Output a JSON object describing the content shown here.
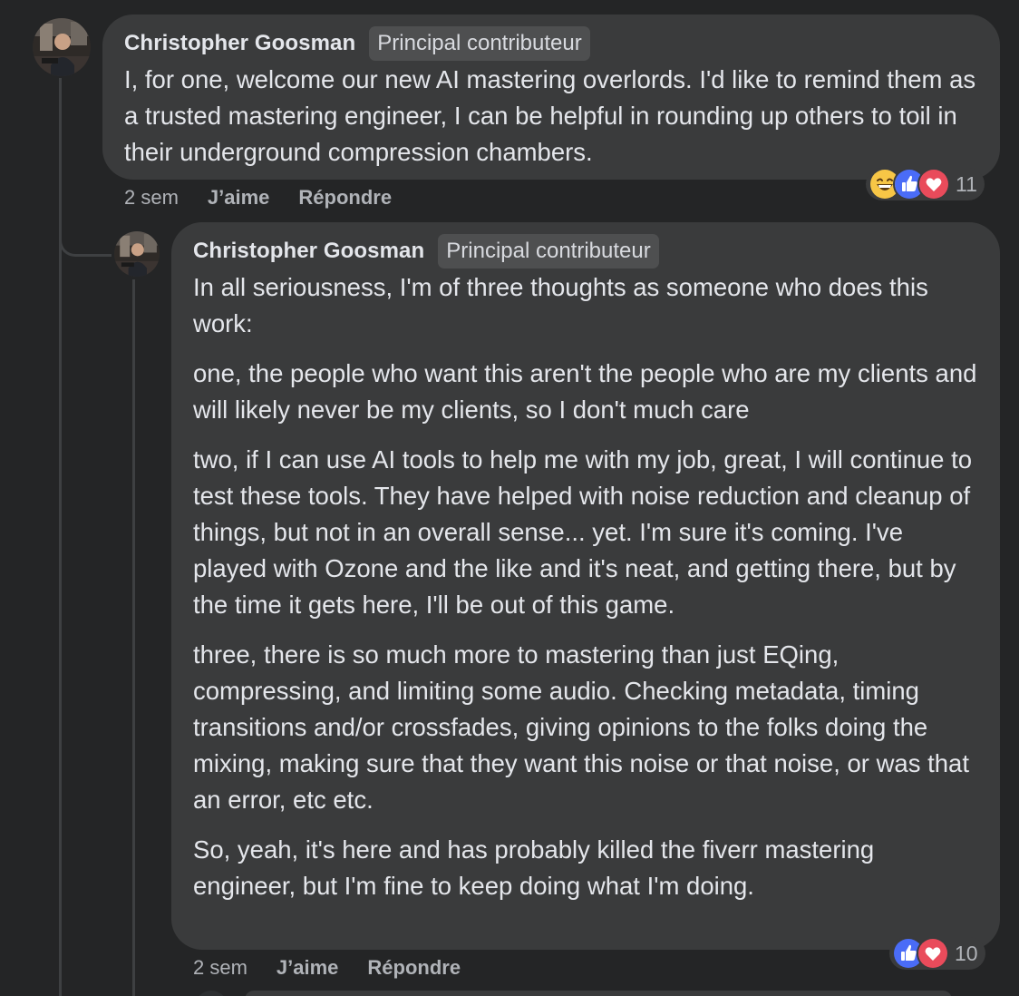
{
  "comments": [
    {
      "author": "Christopher Goosman",
      "badge": "Principal contributeur",
      "paragraphs": [
        "I, for one, welcome our new AI mastering overlords. I'd like to remind them as a trusted mastering engineer, I can be helpful in rounding up others to toil in their underground compression chambers."
      ],
      "time": "2 sem",
      "like_label": "J’aime",
      "reply_label": "Répondre",
      "reaction_icons": [
        "laugh-emoji-icon",
        "like-icon",
        "love-icon"
      ],
      "reaction_count": "11"
    },
    {
      "author": "Christopher Goosman",
      "badge": "Principal contributeur",
      "paragraphs": [
        "In all seriousness, I'm of three thoughts as someone who does this work:",
        "one, the people who want this aren't the people who are my clients and will likely never be my clients, so I don't much care",
        "two, if I can use AI tools to help me with my job, great, I will continue to test these tools. They have helped with noise reduction and cleanup of things, but not in an overall sense... yet. I'm sure it's coming. I've played with Ozone and the like and it's neat, and getting there, but by the time it gets here, I'll be out of this game.",
        "three, there is so much more to mastering than just EQing, compressing, and limiting some audio. Checking metadata, timing transitions and/or crossfades, giving opinions to the folks doing the mixing, making sure that they want this noise or that noise, or was that an error, etc etc.",
        "So, yeah, it's here and has probably killed the fiverr mastering engineer, but I'm fine to keep doing what I'm doing."
      ],
      "time": "2 sem",
      "like_label": "J’aime",
      "reply_label": "Répondre",
      "reaction_icons": [
        "like-icon",
        "love-icon"
      ],
      "reaction_count": "10"
    }
  ],
  "colors": {
    "background": "#242526",
    "bubble": "#3a3b3c",
    "like": "#4a6cf7",
    "love": "#e94b5b",
    "laugh": "#f7c646"
  }
}
